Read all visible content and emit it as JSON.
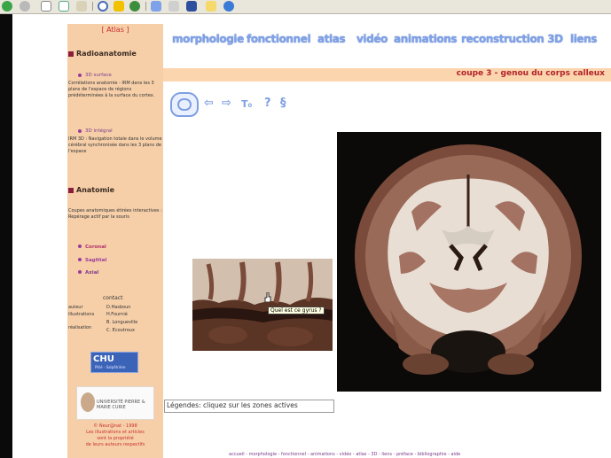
{
  "browser": {
    "icons": [
      "back-icon",
      "forward-icon",
      "stop-icon",
      "reload-icon",
      "home-icon",
      "search-icon",
      "favorites-icon",
      "history-icon",
      "mail-icon",
      "print-icon",
      "edit-icon",
      "folder-icon",
      "messenger-icon"
    ]
  },
  "sidebar": {
    "header": "[ Atlas ]",
    "radioanatomie": {
      "title": "Radioanatomie",
      "items": [
        {
          "label": "3D surface",
          "desc": "Corrélations anatomie - IRM dans les 3 plans de l'espace de régions prédéterminées à la surface du cortex."
        },
        {
          "label": "3D intégral",
          "desc": "IRM 3D : Navigation totale dans le volume cérébral synchronisée dans les 3 plans de l'espace"
        }
      ]
    },
    "anatomie": {
      "title": "Anatomie",
      "desc": "Coupes anatomiques étirées interactives : Repérage actif par la souris",
      "links": [
        "Coronal",
        "Sagittal",
        "Axial"
      ]
    },
    "contact": {
      "title": "contact",
      "rows": [
        {
          "role": "auteur",
          "names": [
            "D.Hasboun"
          ]
        },
        {
          "role": "illustrations",
          "names": [
            "H.Fournié"
          ]
        },
        {
          "role": "réalisation",
          "names": [
            "B. Longueville",
            "C. Ecoutroux"
          ]
        }
      ]
    },
    "chu_logo": {
      "text": "CHU",
      "sub": "Pitié - Salpêtrière"
    },
    "university_logo": {
      "text": "UNIVERSITÉ PIERRE & MARIE CURIE"
    },
    "footer_lines": [
      "© Neur@nat - 1998",
      "Les illustrations et articles",
      "sont la propriété",
      "de leurs auteurs respectifs"
    ]
  },
  "nav": {
    "items": [
      "morphologie",
      "fonctionnel",
      "atlas",
      "vidéo",
      "animations",
      "reconstruction 3D",
      "liens"
    ]
  },
  "title": "coupe 3 - genou du corps calleux",
  "toolbar_icons": [
    {
      "name": "brain-icon"
    },
    {
      "name": "arrow-left-icon",
      "glyph": "⇦"
    },
    {
      "name": "arrow-right-icon",
      "glyph": "⇨"
    },
    {
      "name": "text-size-icon",
      "glyph": "T₀"
    },
    {
      "name": "help-icon",
      "glyph": "?"
    },
    {
      "name": "section-icon",
      "glyph": "§"
    }
  ],
  "tooltip": "Quel est ce gyrus ?",
  "legend": "Légendes: cliquez sur les zones actives",
  "bottom_links": "accueil - morphologie - fonctionnel - animations - vidéo - atlas - 3D - liens - préface - bibliographie - aide"
}
